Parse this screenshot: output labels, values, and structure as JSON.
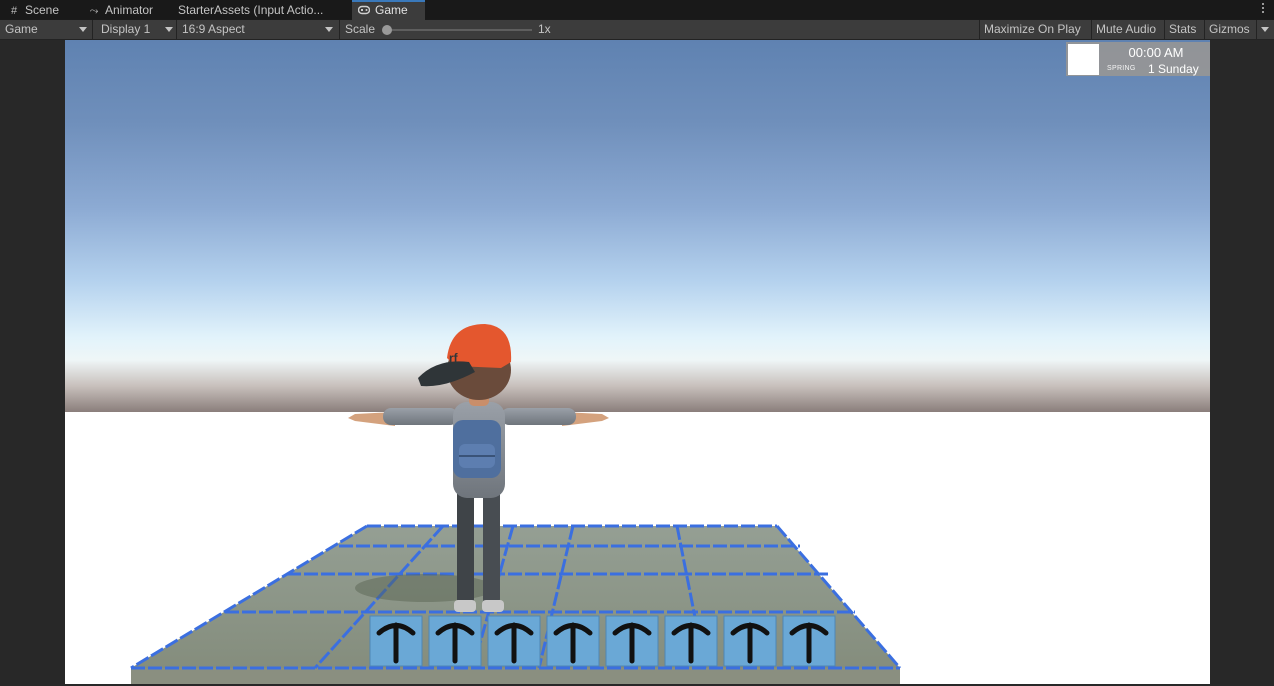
{
  "tabs": [
    {
      "label": "Scene",
      "icon": "grid-icon"
    },
    {
      "label": "Animator",
      "icon": "animator-icon"
    },
    {
      "label": "StarterAssets (Input Actio...",
      "icon": ""
    },
    {
      "label": "Game",
      "icon": "gamepad-icon",
      "active": true
    }
  ],
  "toolbar": {
    "view_select": "Game",
    "display_select": "Display 1",
    "aspect_select": "16:9 Aspect",
    "scale_label": "Scale",
    "scale_value": "1x",
    "scale_fraction": 0.0,
    "maximize_on_play": "Maximize On Play",
    "mute_audio": "Mute Audio",
    "stats": "Stats",
    "gizmos": "Gizmos"
  },
  "hud": {
    "time": "00:00 AM",
    "season": "SPRING",
    "day": "1 Sunday",
    "hotbar_slots": 8,
    "hotbar_item_icon": "hoe-tool-icon"
  },
  "colors": {
    "active_tab_accent": "#3a79bb",
    "grid_line": "#3b6fe0",
    "hotbar_slot": "#6aa8d6",
    "cap": "#e4572e"
  }
}
